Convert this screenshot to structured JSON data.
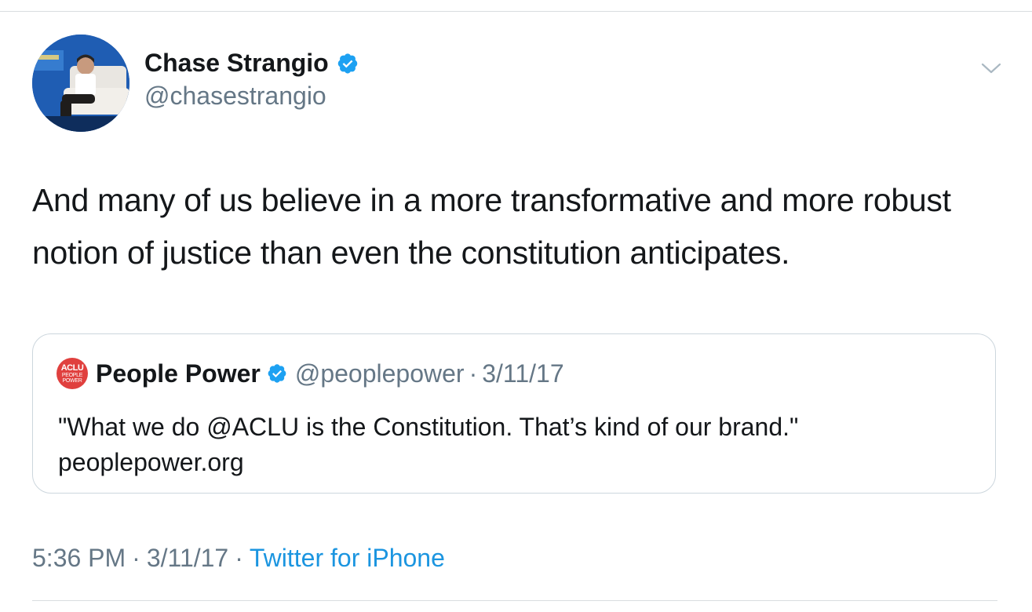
{
  "tweet": {
    "author": {
      "name": "Chase Strangio",
      "handle": "@chasestrangio",
      "verified": true
    },
    "text": "And many of us believe in a more transformative and more robust notion of justice than even the constitution anticipates.",
    "quoted": {
      "logo_line1": "ACLU",
      "logo_line2": "PEOPLE",
      "logo_line3": "POWER",
      "name": "People Power",
      "verified": true,
      "handle": "@peoplepower",
      "separator": "·",
      "date": "3/11/17",
      "text": "\"What we do @ACLU is the Constitution. That’s kind of our brand.\" peoplepower.org"
    },
    "meta": {
      "time": "5:36 PM",
      "separator": "·",
      "date": "3/11/17",
      "source": "Twitter for iPhone"
    }
  },
  "icons": {
    "verified": "verified-badge-icon",
    "menu": "chevron-down-icon"
  },
  "colors": {
    "link_blue": "#1b95e0",
    "verified_blue": "#1da1f2",
    "secondary_text": "#657786",
    "primary_text": "#14171a",
    "aclu_red": "#e0403e"
  }
}
